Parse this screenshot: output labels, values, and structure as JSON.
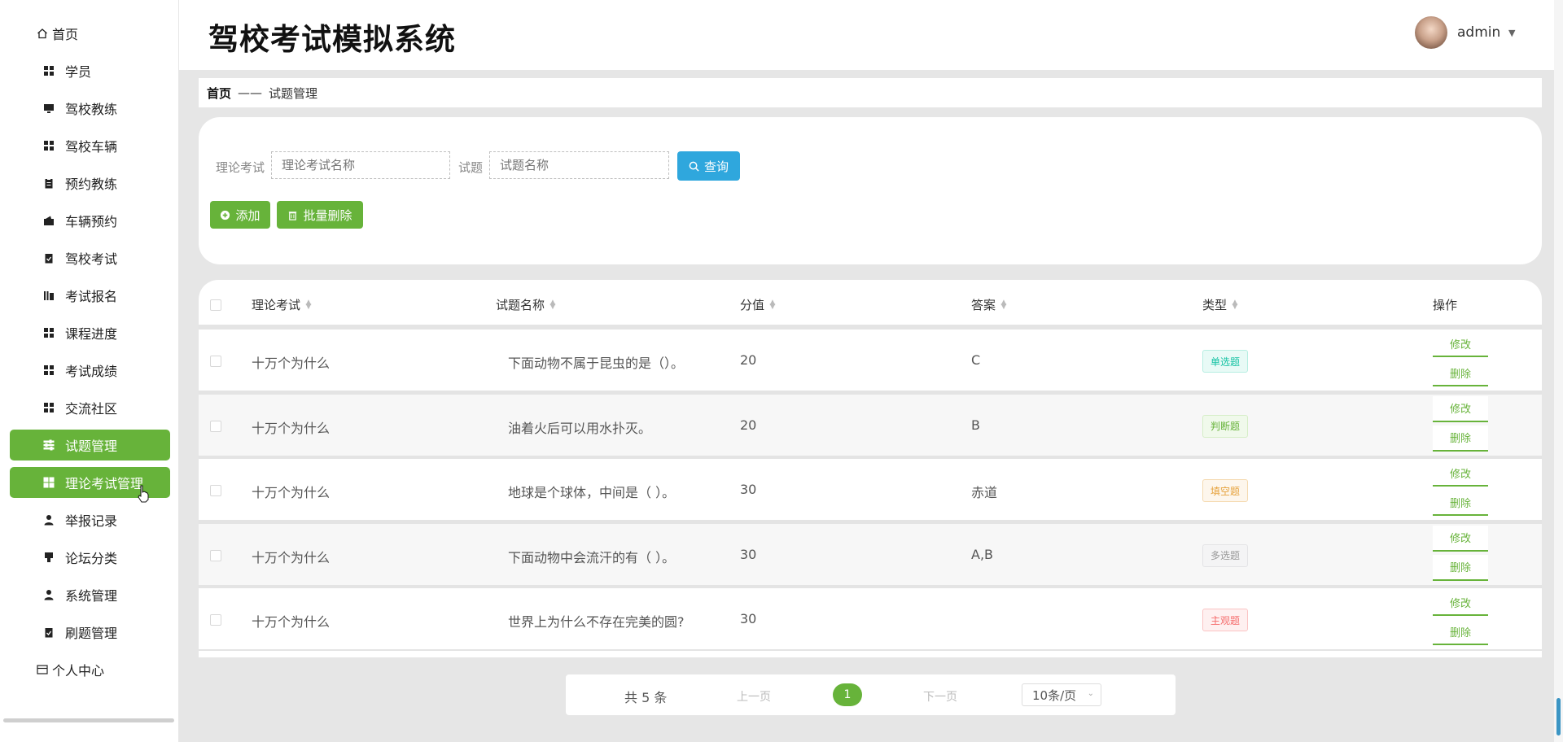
{
  "app": {
    "title": "驾校考试模拟系统"
  },
  "user": {
    "name": "admin"
  },
  "sidebar": {
    "items": [
      {
        "label": "首页",
        "icon": "home-icon",
        "top": true
      },
      {
        "label": "学员",
        "icon": "grid-icon"
      },
      {
        "label": "驾校教练",
        "icon": "monitor-icon"
      },
      {
        "label": "驾校车辆",
        "icon": "grid-icon"
      },
      {
        "label": "预约教练",
        "icon": "clipboard-icon"
      },
      {
        "label": "车辆预约",
        "icon": "wallet-icon"
      },
      {
        "label": "驾校考试",
        "icon": "clipboard-check-icon"
      },
      {
        "label": "考试报名",
        "icon": "bar-icon"
      },
      {
        "label": "课程进度",
        "icon": "grid-icon"
      },
      {
        "label": "考试成绩",
        "icon": "grid-icon"
      },
      {
        "label": "交流社区",
        "icon": "grid-icon"
      },
      {
        "label": "试题管理",
        "icon": "sliders-icon",
        "active": true
      },
      {
        "label": "理论考试管理",
        "icon": "grid-icon",
        "active": true
      },
      {
        "label": "举报记录",
        "icon": "person-icon"
      },
      {
        "label": "论坛分类",
        "icon": "stamp-icon"
      },
      {
        "label": "系统管理",
        "icon": "person-icon"
      },
      {
        "label": "刷题管理",
        "icon": "clipboard-check-icon"
      },
      {
        "label": "个人中心",
        "icon": "card-icon",
        "top": true
      }
    ]
  },
  "breadcrumb": {
    "home": "首页",
    "separator": "——",
    "current": "试题管理"
  },
  "search": {
    "exam_label": "理论考试",
    "exam_placeholder": "理论考试名称",
    "question_label": "试题",
    "question_placeholder": "试题名称",
    "query_label": "查询",
    "add_label": "添加",
    "batch_delete_label": "批量删除"
  },
  "table": {
    "headers": [
      "理论考试",
      "试题名称",
      "分值",
      "答案",
      "类型",
      "操作"
    ],
    "edit_label": "修改",
    "delete_label": "删除",
    "rows": [
      {
        "exam": "十万个为什么",
        "name": "下面动物不属于昆虫的是（）。",
        "score": "20",
        "answer": "C",
        "type": "单选题",
        "type_color": "#13c2a3",
        "type_bg": "#e8faf6",
        "type_border": "#b7eee2"
      },
      {
        "exam": "十万个为什么",
        "name": "油着火后可以用水扑灭。",
        "score": "20",
        "answer": "B",
        "type": "判断题",
        "type_color": "#67b33a",
        "type_bg": "#f0f9eb",
        "type_border": "#d6eec8"
      },
      {
        "exam": "十万个为什么",
        "name": "地球是个球体，中间是（ ）。",
        "score": "30",
        "answer": "赤道",
        "type": "填空题",
        "type_color": "#e6a23c",
        "type_bg": "#fdf6ec",
        "type_border": "#f5dab1"
      },
      {
        "exam": "十万个为什么",
        "name": "下面动物中会流汗的有（ ）。",
        "score": "30",
        "answer": "A,B",
        "type": "多选题",
        "type_color": "#999999",
        "type_bg": "#f4f4f5",
        "type_border": "#e4e4e6"
      },
      {
        "exam": "十万个为什么",
        "name": "世界上为什么不存在完美的圆?",
        "score": "30",
        "answer": "",
        "type": "主观题",
        "type_color": "#f56c6c",
        "type_bg": "#fef0f0",
        "type_border": "#fbc4c4"
      }
    ]
  },
  "pagination": {
    "total": "共 5 条",
    "prev": "上一页",
    "current_page": "1",
    "next": "下一页",
    "page_size": "10条/页"
  },
  "colors": {
    "accent": "#67b33a",
    "query": "#2fa7dd"
  }
}
